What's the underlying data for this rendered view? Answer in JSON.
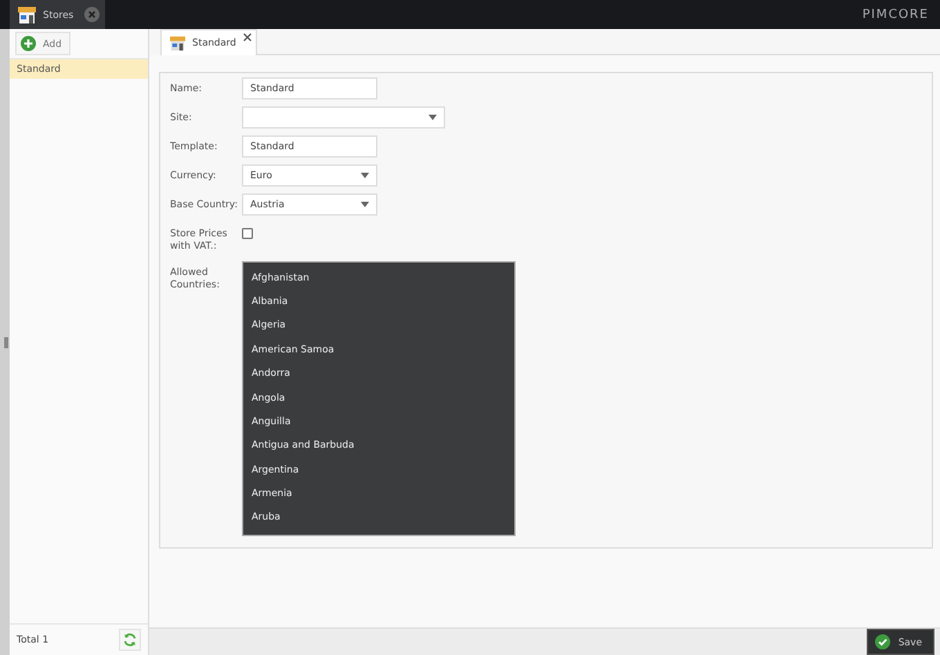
{
  "top_tabs": [
    {
      "label": "Stores",
      "selected": true
    }
  ],
  "logo": "PIMCORE",
  "sidebar": {
    "add_button": "Add",
    "items": [
      {
        "label": "Standard",
        "selected": true
      }
    ],
    "total": "Total 1"
  },
  "editor_tabs": [
    {
      "label": "Standard",
      "selected": true
    }
  ],
  "form": {
    "fields": [
      {
        "kind": "text",
        "label": "Name:",
        "value": "Standard"
      },
      {
        "kind": "select",
        "label": "Site:",
        "wide": true
      },
      {
        "kind": "text",
        "label": "Template:",
        "value": "Standard"
      },
      {
        "kind": "select",
        "label": "Currency:",
        "value": "Euro",
        "wide": false
      },
      {
        "kind": "select",
        "label": "Base Country:",
        "value": "Austria",
        "wide": false
      },
      {
        "kind": "checkbox",
        "label": "Store Prices with VAT.:",
        "checked": false
      },
      {
        "kind": "list",
        "label": "Allowed Countries:",
        "options": [
          "Afghanistan",
          "Albania",
          "Algeria",
          "American Samoa",
          "Andorra",
          "Angola",
          "Anguilla",
          "Antigua and Barbuda",
          "Argentina",
          "Armenia",
          "Aruba"
        ]
      }
    ]
  },
  "save_button": "Save"
}
